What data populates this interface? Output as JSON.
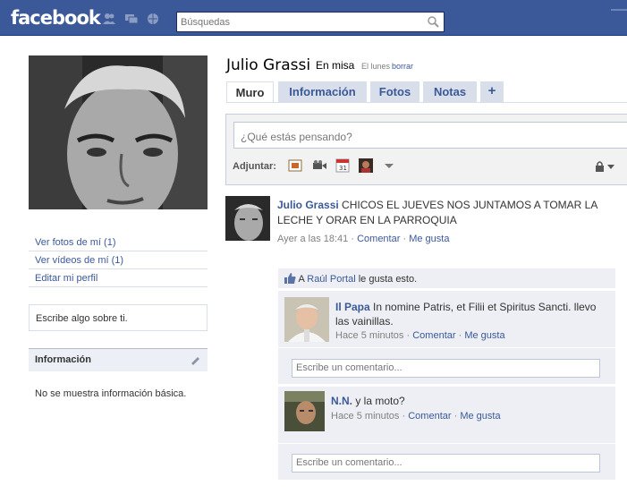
{
  "topbar": {
    "logo": "facebook",
    "search_placeholder": "Búsquedas",
    "jewels": [
      "friend-requests-icon",
      "messages-icon",
      "notifications-icon"
    ]
  },
  "profile": {
    "name": "Julio Grassi",
    "status": "En misa",
    "status_time": "El lunes",
    "status_clear": "borrar"
  },
  "sidebar": {
    "links": [
      "Ver fotos de mí  (1)",
      "Ver vídeos de mí (1)",
      "Editar mi perfil"
    ],
    "write_about": "Escribe algo sobre ti.",
    "info_title": "Información",
    "info_text": "No se muestra información básica."
  },
  "tabs": [
    {
      "label": "Muro"
    },
    {
      "label": "Información"
    },
    {
      "label": "Fotos"
    },
    {
      "label": "Notas"
    },
    {
      "label": "+"
    }
  ],
  "composer": {
    "placeholder": "¿Qué estás pensando?",
    "attach_label": "Adjuntar:",
    "attach_icons": [
      "photo-icon",
      "video-icon",
      "event-icon",
      "link-icon",
      "more-icon"
    ]
  },
  "post": {
    "author": "Julio Grassi",
    "text": "CHICOS EL JUEVES NOS JUNTAMOS A TOMAR LA LECHE Y ORAR EN LA PARROQUIA",
    "time": "Ayer a las 18:41",
    "sep": "·",
    "comment": "Comentar",
    "like": "Me gusta"
  },
  "likes": {
    "prefix": "A",
    "name": "Raúl Portal",
    "suffix": "le gusta esto."
  },
  "comments": [
    {
      "author": "Il Papa",
      "text": "In nomine Patris, et Filii et Spiritus Sancti. llevo las vainillas.",
      "time": "Hace 5 minutos",
      "comment": "Comentar",
      "like": "Me gusta",
      "input_placeholder": "Escribe un comentario..."
    },
    {
      "author": "N.N.",
      "text": "y la moto?",
      "time": "Hace 5 minutos",
      "comment": "Comentar",
      "like": "Me gusta",
      "input_placeholder": "Escribe un comentario..."
    }
  ],
  "colors": {
    "brand": "#3b5998",
    "link": "#3b5998",
    "panel": "#edeff4"
  }
}
